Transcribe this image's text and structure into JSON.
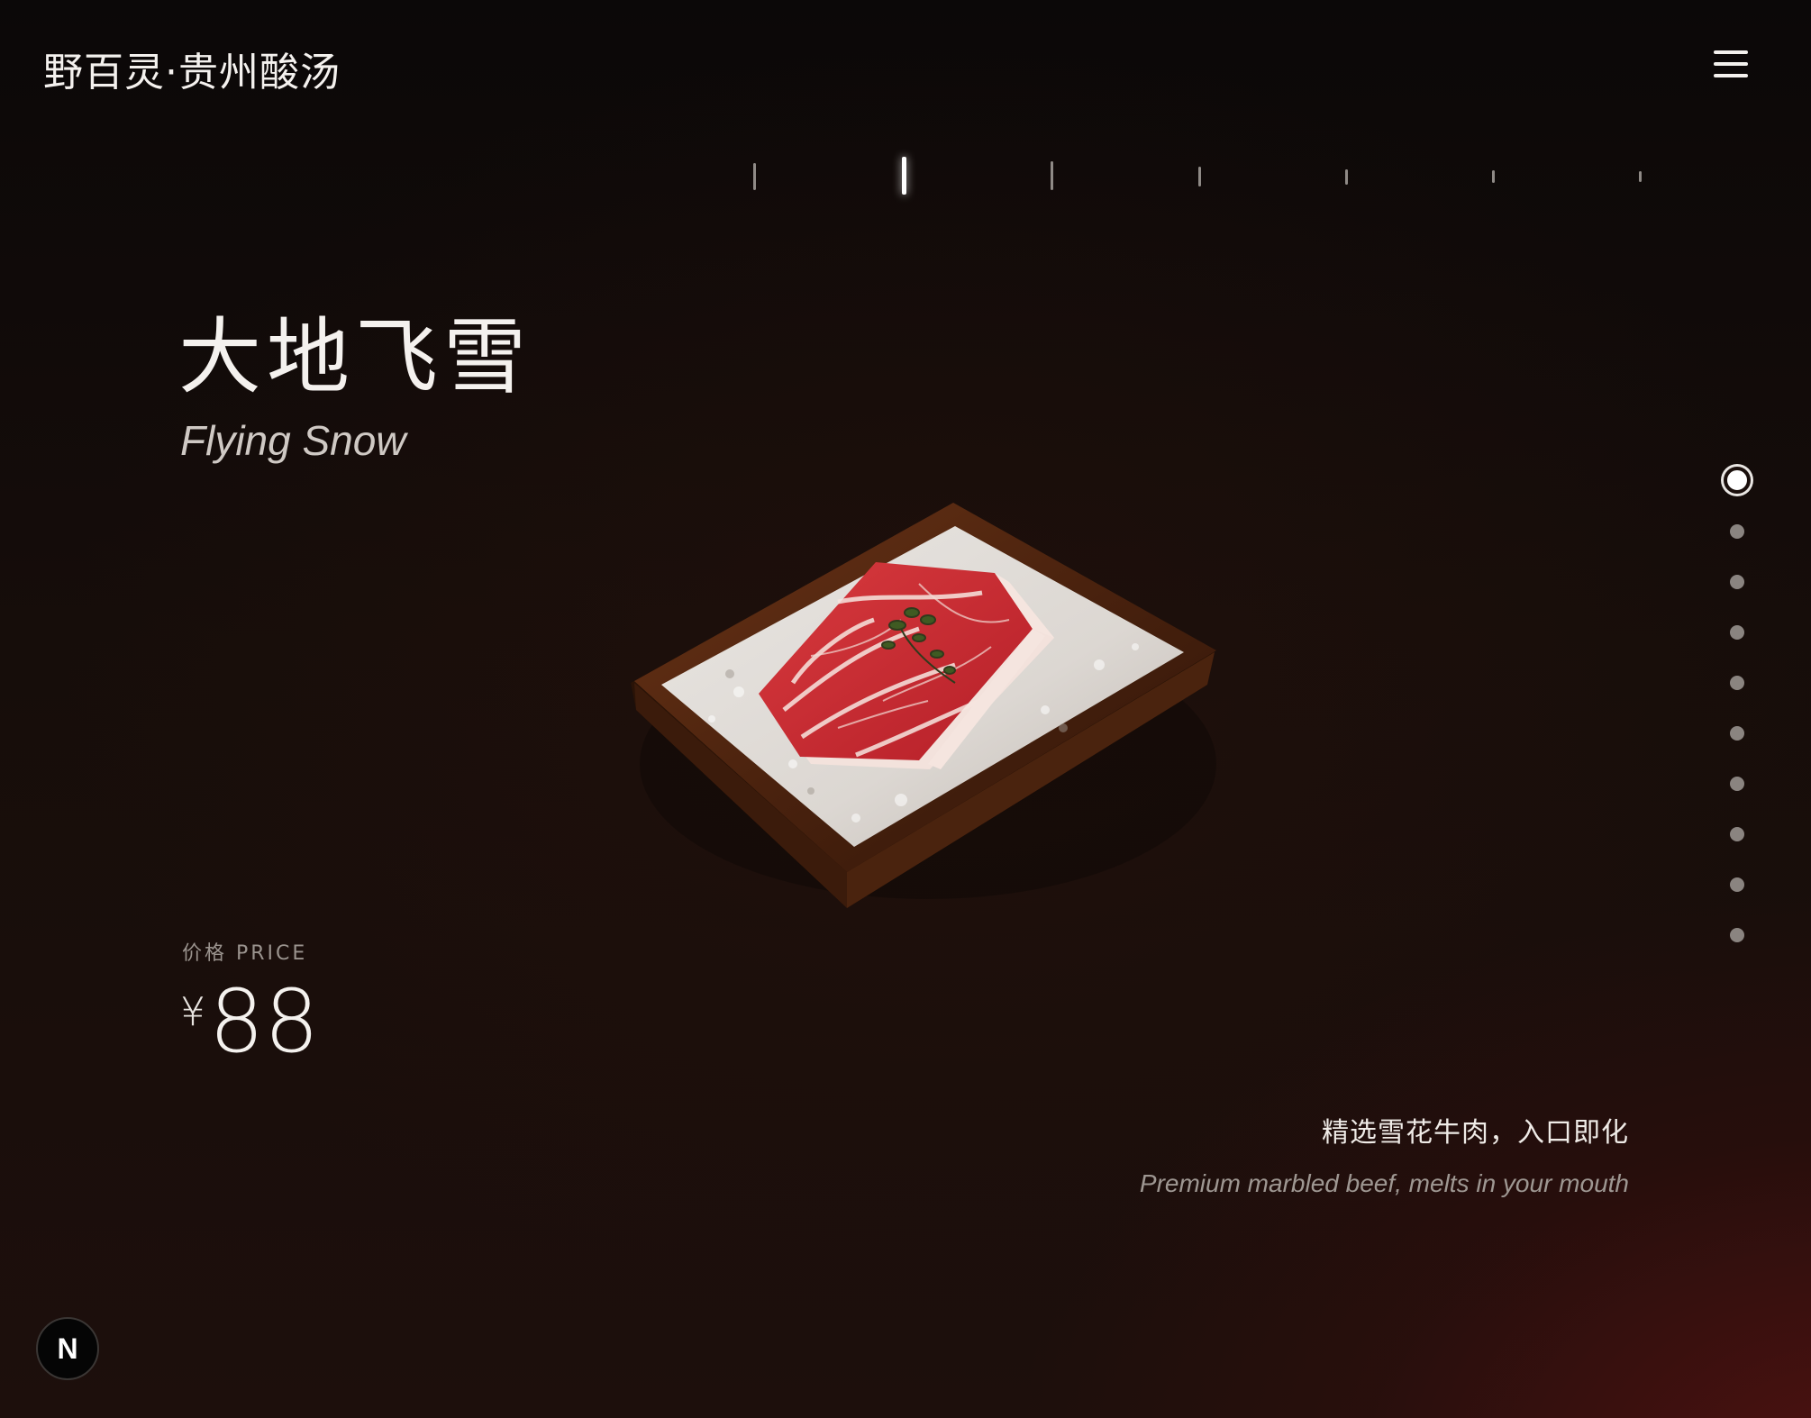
{
  "header": {
    "brand": "野百灵·贵州酸汤",
    "menu_icon": "hamburger-menu-icon"
  },
  "carousel": {
    "tick_count": 7,
    "active_tick_index": 1,
    "slide_count": 10,
    "active_slide_index": 0
  },
  "dish": {
    "name_zh": "大地飞雪",
    "name_en": "Flying Snow",
    "image": "marbled-beef-on-ice-tray",
    "price_label": "价格 PRICE",
    "currency": "¥",
    "price": "88",
    "description_zh": "精选雪花牛肉，入口即化",
    "description_en": "Premium marbled beef, melts in your mouth"
  },
  "badge": {
    "letter": "N"
  },
  "colors": {
    "background_top": "#0b0808",
    "background_glow": "#761414",
    "text": "#f4f1ee",
    "muted": "#9a938e",
    "dot_inactive": "#8a8480"
  }
}
